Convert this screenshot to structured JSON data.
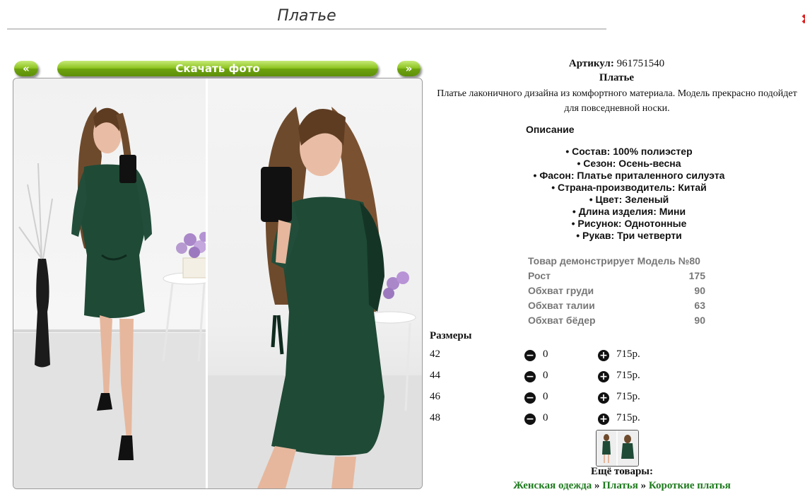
{
  "page": {
    "title": "Платье"
  },
  "gallery": {
    "prev_label": "«",
    "download_label": "Скачать фото",
    "next_label": "»"
  },
  "product": {
    "article_label": "Артикул:",
    "article_value": "961751540",
    "name": "Платье",
    "description": "Платье лаконичного дизайна из комфортного материала. Модель прекрасно подойдет для повседневной носки.",
    "description_heading": "Описание",
    "features": [
      "Состав: 100% полиэстер",
      "Сезон: Осень-весна",
      "Фасон: Платье приталенного силуэта",
      "Страна-производитель: Китай",
      "Цвет: Зеленый",
      "Длина изделия: Мини",
      "Рисунок: Однотонные",
      "Рукав: Три четверти"
    ]
  },
  "model": {
    "rows": [
      {
        "label": "Товар демонстрирует Модель №80",
        "value": ""
      },
      {
        "label": "Рост",
        "value": "175"
      },
      {
        "label": "Обхват груди",
        "value": "90"
      },
      {
        "label": "Обхват талии",
        "value": "63"
      },
      {
        "label": "Обхват бёдер",
        "value": "90"
      }
    ]
  },
  "sizes": {
    "heading": "Размеры",
    "rows": [
      {
        "size": "42",
        "qty": "0",
        "price": "715р."
      },
      {
        "size": "44",
        "qty": "0",
        "price": "715р."
      },
      {
        "size": "46",
        "qty": "0",
        "price": "715р."
      },
      {
        "size": "48",
        "qty": "0",
        "price": "715р."
      }
    ]
  },
  "more": {
    "heading": "Ещё товары:",
    "breadcrumbs": [
      "Женская одежда",
      "Платья",
      "Короткие платья"
    ],
    "separator": "»"
  },
  "colors": {
    "button_green": "#7fb51a",
    "link_green": "#1e7a1e",
    "dress_green": "#1f4a36"
  }
}
